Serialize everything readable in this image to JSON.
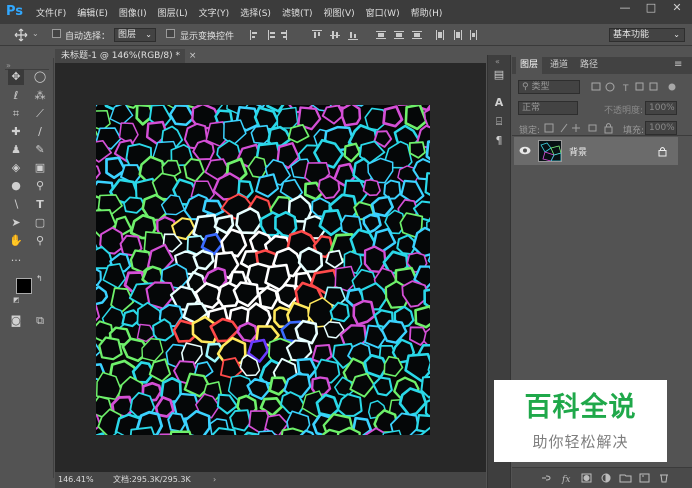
{
  "app": {
    "logo": "Ps"
  },
  "menu": [
    "文件(F)",
    "编辑(E)",
    "图像(I)",
    "图层(L)",
    "文字(Y)",
    "选择(S)",
    "滤镜(T)",
    "视图(V)",
    "窗口(W)",
    "帮助(H)"
  ],
  "window_controls": {
    "minimize": "—",
    "restore": "□",
    "close": "✕"
  },
  "options_bar": {
    "auto_select_label": "自动选择：",
    "auto_select_value": "图层",
    "show_transform_label": "显示变换控件",
    "workspace": "基本功能"
  },
  "document": {
    "tab_title": "未标题-1 @ 146%(RGB/8) *",
    "zoom": "146.41%",
    "file_info": "文档:295.3K/295.3K"
  },
  "layers_panel": {
    "tabs": [
      "图层",
      "通道",
      "路径"
    ],
    "filter_kind": "类型",
    "blend_mode": "正常",
    "opacity_label": "不透明度:",
    "opacity_value": "100%",
    "lock_label": "锁定:",
    "fill_label": "填充:",
    "fill_value": "100%",
    "layer_name": "背景"
  },
  "watermark": {
    "title": "百科全说",
    "subtitle": "助你轻松解决"
  },
  "colors": {
    "accent": "#31a8ff",
    "watermark_green": "#1fa84a"
  }
}
